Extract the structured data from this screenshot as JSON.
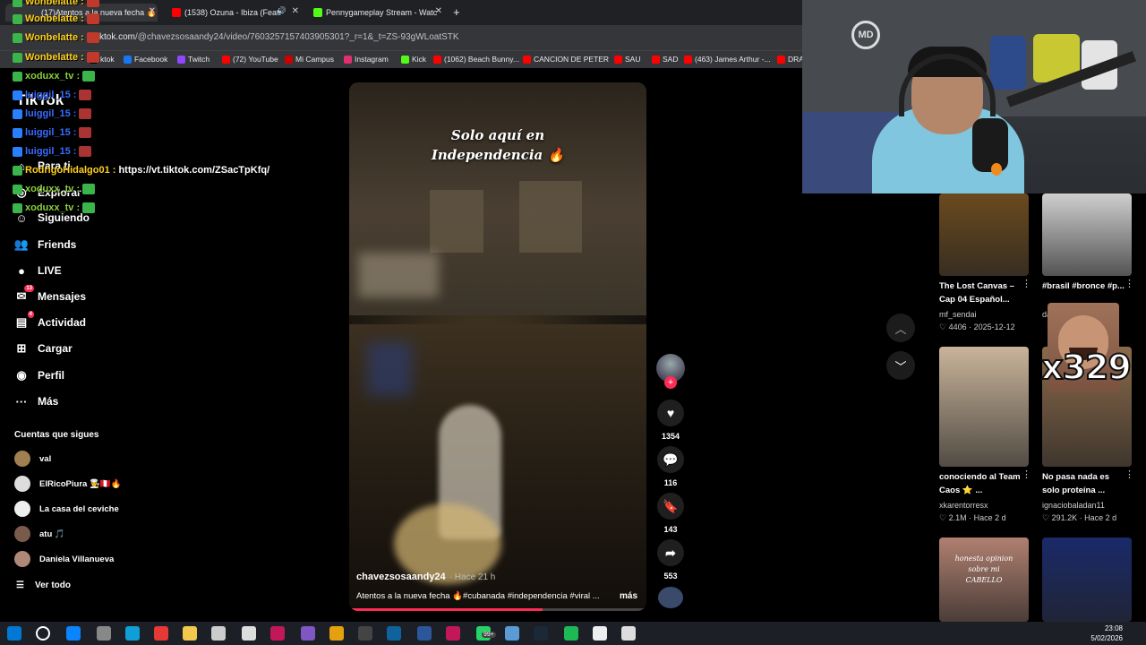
{
  "browser": {
    "tabs": [
      {
        "label": "(17)Atentos a la nueva fecha 🔥",
        "color": "#222"
      },
      {
        "label": "(1538) Ozuna - Ibiza (Feat.",
        "color": "#ff0000"
      },
      {
        "label": "Pennygameplay Stream - Watc",
        "color": "#53fc18"
      }
    ],
    "new_tab": "+",
    "url_host": "tiktok.com",
    "url_path": "/@chavezsosaandy24/video/7603257157403905301?_r=1&_t=ZS-93gWLoatSTK",
    "bookmarks": [
      {
        "label": "ktok",
        "color": "#000"
      },
      {
        "label": "Facebook",
        "color": "#1877f2"
      },
      {
        "label": "Twitch",
        "color": "#9146ff"
      },
      {
        "label": "(72) YouTube",
        "color": "#ff0000"
      },
      {
        "label": "Mi Campus",
        "color": "#c00"
      },
      {
        "label": "Instagram",
        "color": "#e1306c"
      },
      {
        "label": "Kick",
        "color": "#53fc18"
      },
      {
        "label": "(1062) Beach Bunny...",
        "color": "#ff0000"
      },
      {
        "label": "CANCION DE PETER",
        "color": "#ff0000"
      },
      {
        "label": "SAU",
        "color": "#ff0000"
      },
      {
        "label": "SAD",
        "color": "#ff0000"
      },
      {
        "label": "(463) James Arthur -...",
        "color": "#ff0000"
      },
      {
        "label": "DRA",
        "color": "#ff0000"
      }
    ]
  },
  "chat": [
    {
      "user": "Wonbelatte :",
      "color": "#ffd11a",
      "emote": "#c0392b"
    },
    {
      "user": "Wonbelatte :",
      "color": "#ffd11a",
      "emote": "#c0392b"
    },
    {
      "user": "Wonbelatte :",
      "color": "#ffd11a",
      "emote": "#c0392b"
    },
    {
      "user": "Wonbelatte :",
      "color": "#ffd11a",
      "emote": "#c0392b"
    },
    {
      "user": "xoduxx_tv :",
      "color": "#8ad13a",
      "emote": "#3bb54a"
    },
    {
      "user": "luiggil_15 :",
      "color": "#3a6bff",
      "emote": "#a33"
    },
    {
      "user": "luiggil_15 :",
      "color": "#3a6bff",
      "emote": "#a33"
    },
    {
      "user": "luiggil_15 :",
      "color": "#3a6bff",
      "emote": "#a33"
    },
    {
      "user": "luiggil_15 :",
      "color": "#3a6bff",
      "emote": "#a33"
    },
    {
      "user": "RodrigoHidalgo01 :",
      "color": "#ffd11a",
      "msg": "https://vt.tiktok.com/ZSacTpKfq/"
    },
    {
      "user": "xoduxx_tv :",
      "color": "#8ad13a",
      "emote": "#3bb54a"
    },
    {
      "user": "xoduxx_tv :",
      "color": "#8ad13a",
      "emote": "#3bb54a"
    }
  ],
  "tiktok": {
    "logo": "TikTok",
    "nav": [
      {
        "label": "Para ti",
        "icon": "home-icon"
      },
      {
        "label": "Explorar",
        "icon": "compass-icon"
      },
      {
        "label": "Siguiendo",
        "icon": "following-icon"
      },
      {
        "label": "Friends",
        "icon": "friends-icon"
      },
      {
        "label": "LIVE",
        "icon": "live-icon"
      },
      {
        "label": "Mensajes",
        "icon": "messages-icon",
        "badge": "13"
      },
      {
        "label": "Actividad",
        "icon": "activity-icon",
        "badge": "4"
      },
      {
        "label": "Cargar",
        "icon": "upload-icon"
      },
      {
        "label": "Perfil",
        "icon": "profile-icon"
      },
      {
        "label": "Más",
        "icon": "more-icon"
      }
    ],
    "follows_title": "Cuentas que sigues",
    "follows": [
      {
        "name": "val",
        "color": "#a08050"
      },
      {
        "name": "ElRicoPiura 👨‍🍳🇵🇪🔥",
        "color": "#ddd"
      },
      {
        "name": "La casa del ceviche",
        "color": "#eee"
      },
      {
        "name": "atu 🎵",
        "color": "#7a5a4a"
      },
      {
        "name": "Daniela Villanueva",
        "color": "#b08878"
      }
    ],
    "see_all": "Ver todo"
  },
  "video": {
    "caption_line1": "Solo aquí en",
    "caption_line2": "Independencia 🔥",
    "author": "chavezsosaandy24",
    "time_ago": "· Hace 21 h",
    "description": "Atentos a la nueva fecha 🔥#cubanada #independencia #viral ...",
    "more": "más",
    "likes": "1354",
    "comments": "116",
    "saves": "143",
    "shares": "553",
    "progress": 0.65
  },
  "recommendations": [
    {
      "title": "The Lost Canvas – Cap 04 Español...",
      "author": "mf_sendai",
      "likes": "4406",
      "date": "2025-12-12",
      "thumb": "#6b4a1e"
    },
    {
      "title": "#brasil #bronce #p...",
      "author": "da...",
      "likes": "",
      "date": "",
      "thumb": "#cfcfcf"
    },
    {
      "title": "conociendo al Team Caos ⭐ ...",
      "author": "xkarentorresx",
      "likes": "2.1M",
      "date": "Hace 2 d",
      "thumb": "#c9b49a"
    },
    {
      "title": "No pasa nada es solo proteína ...",
      "author": "ignaciobaladan11",
      "likes": "291.2K",
      "date": "Hace 2 d",
      "thumb": "#8a6a4a"
    },
    {
      "title": "",
      "author": "",
      "likes": "",
      "date": "",
      "thumb": "#b08070",
      "overlay": "honesta opinion sobre mi CABELLO"
    },
    {
      "title": "",
      "author": "",
      "likes": "",
      "date": "",
      "thumb": "#1a2a6a"
    }
  ],
  "meme_text": "x329",
  "webcam_logo": "MD",
  "taskbar": {
    "time": "23:08",
    "date": "5/02/2026",
    "icons": [
      "windows-icon",
      "search-icon",
      "store-icon",
      "app-icon",
      "edge-icon",
      "app-red-icon",
      "folder-icon",
      "app-icon",
      "app-icon",
      "app-icon",
      "app-icon",
      "chrome-icon",
      "chrome-icon",
      "calculator-icon",
      "word-icon",
      "app-icon",
      "whatsapp-icon",
      "app-icon",
      "steam-icon",
      "spotify-icon",
      "app-icon",
      "app-icon"
    ],
    "colors": [
      "#0078d4",
      "#fff",
      "#0a84ff",
      "#888",
      "#0f9ed5",
      "#e53935",
      "#f2c94c",
      "#ccc",
      "#ddd",
      "#c2185b",
      "#7e57c2",
      "#e5a00d",
      "#444",
      "#0e639c",
      "#2b579a",
      "#c2185b",
      "#25d366",
      "#5a9bd5",
      "#1b2838",
      "#1db954",
      "#eee",
      "#ddd"
    ],
    "whatsapp_badge": "99+"
  }
}
